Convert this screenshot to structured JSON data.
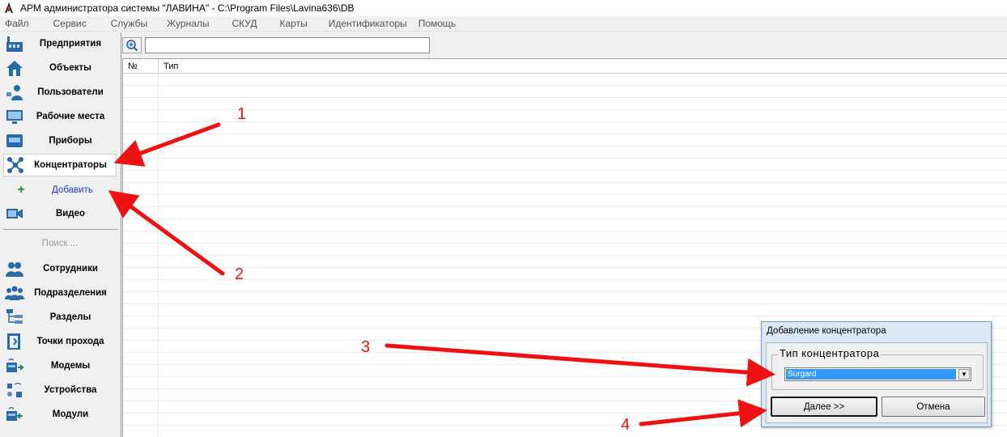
{
  "window": {
    "title": "АРМ администратора системы \"ЛАВИНА\" - C:\\Program Files\\Lavina636\\DB"
  },
  "menu": [
    {
      "label": "Файл"
    },
    {
      "label": "Сервис"
    },
    {
      "label": "Службы"
    },
    {
      "label": "Журналы"
    },
    {
      "label": "СКУД"
    },
    {
      "label": "Карты"
    },
    {
      "label": "Идентификаторы"
    },
    {
      "label": "Помощь"
    }
  ],
  "sidebar": {
    "items": [
      {
        "label": "Предприятия",
        "icon": "factory-icon"
      },
      {
        "label": "Объекты",
        "icon": "house-icon"
      },
      {
        "label": "Пользователи",
        "icon": "user-icon"
      },
      {
        "label": "Рабочие места",
        "icon": "monitor-icon"
      },
      {
        "label": "Приборы",
        "icon": "device-icon"
      },
      {
        "label": "Концентраторы",
        "icon": "hub-icon",
        "selected": true
      },
      {
        "label": "Видео",
        "icon": "video-icon"
      }
    ],
    "add_label": "Добавить",
    "search_label": "Поиск ...",
    "search_items": [
      {
        "label": "Сотрудники",
        "icon": "employees-icon"
      },
      {
        "label": "Подразделения",
        "icon": "departments-icon"
      },
      {
        "label": "Разделы",
        "icon": "sections-icon"
      },
      {
        "label": "Точки прохода",
        "icon": "door-icon"
      },
      {
        "label": "Модемы",
        "icon": "modem-icon"
      },
      {
        "label": "Устройства",
        "icon": "devices-icon"
      },
      {
        "label": "Модули",
        "icon": "module-icon"
      }
    ]
  },
  "toolbar": {
    "zoom_icon": "magnifier-icon",
    "search_value": ""
  },
  "grid": {
    "columns": [
      "№",
      "Тип"
    ]
  },
  "dialog": {
    "title": "Добавление концентратора",
    "group_label": "Тип концентратора",
    "selected_type": "Surgard",
    "next_label": "Далее >>",
    "cancel_label": "Отмена"
  },
  "annotations": {
    "color": "#e11111",
    "labels": [
      "1",
      "2",
      "3",
      "4"
    ]
  }
}
